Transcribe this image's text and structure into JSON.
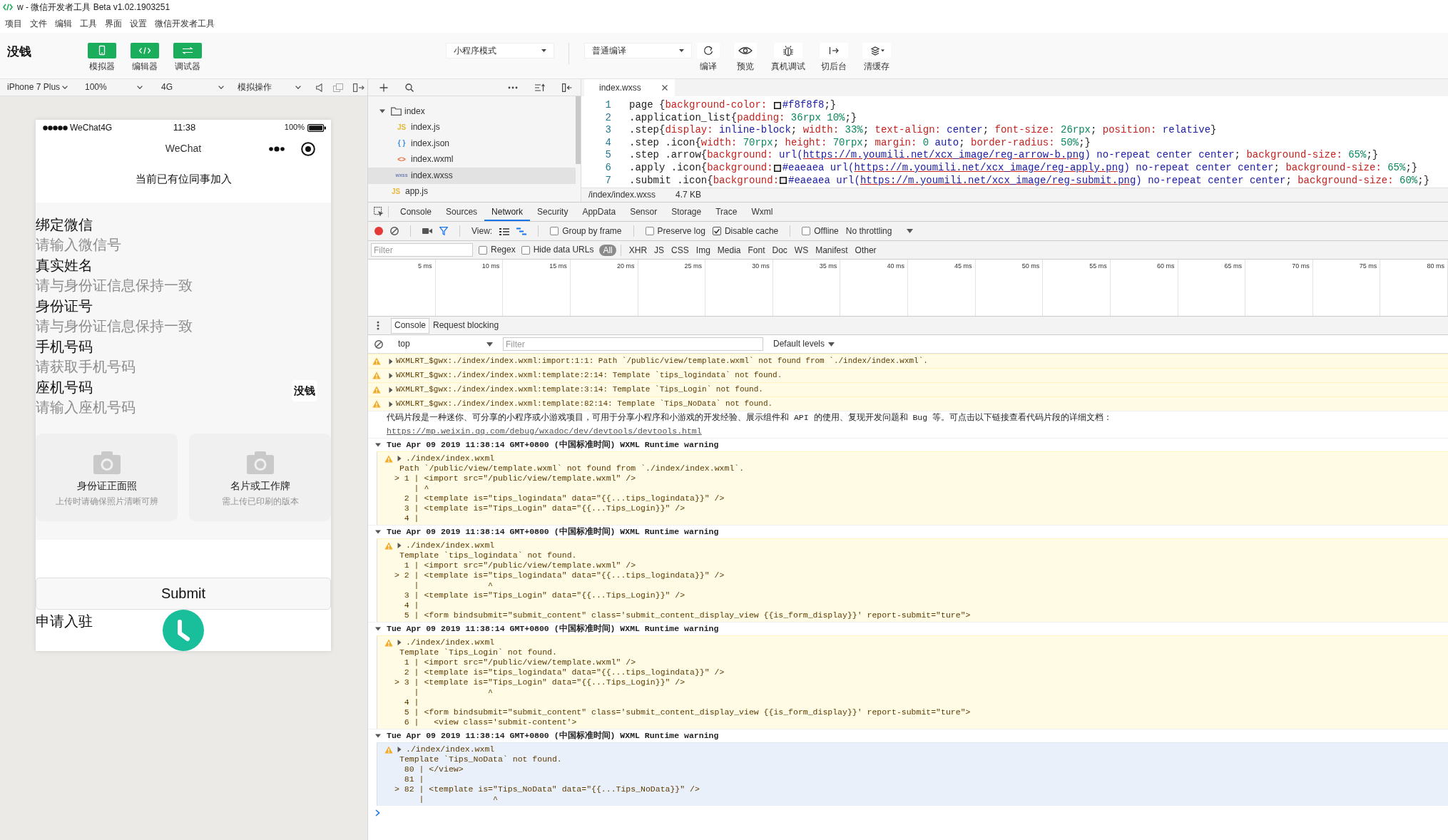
{
  "window": {
    "title": "w - 微信开发者工具 Beta v1.02.1903251"
  },
  "menu": [
    "项目",
    "文件",
    "编辑",
    "工具",
    "界面",
    "设置",
    "微信开发者工具"
  ],
  "toolbar": {
    "logo": "没钱",
    "view_buttons": [
      {
        "kind": "phone",
        "label": "模拟器",
        "on": true
      },
      {
        "kind": "code",
        "label": "编辑器",
        "on": true
      },
      {
        "kind": "swap",
        "label": "调试器",
        "on": true
      }
    ],
    "mode": "小程序模式",
    "compile": "普通编译",
    "actions": [
      {
        "kind": "refresh",
        "label": "编译"
      },
      {
        "kind": "eye",
        "label": "预览"
      },
      {
        "kind": "bug",
        "label": "真机调试"
      },
      {
        "kind": "background",
        "label": "切后台"
      },
      {
        "kind": "layers",
        "label": "清缓存"
      }
    ]
  },
  "simulator": {
    "device": "iPhone 7 Plus",
    "zoom": "100%",
    "network": "4G",
    "operation": "模拟操作",
    "phone": {
      "carrier": "WeChat4G",
      "time": "11:38",
      "battery": "100%",
      "nav_title": "WeChat",
      "header": "当前已有位同事加入",
      "fields": [
        {
          "label": "绑定微信",
          "placeholder": "请输入微信号"
        },
        {
          "label": "真实姓名",
          "placeholder": "请与身份证信息保持一致"
        },
        {
          "label": "身份证号",
          "placeholder": "请与身份证信息保持一致"
        },
        {
          "label": "手机号码",
          "placeholder": "请获取手机号码"
        },
        {
          "label": "座机号码",
          "placeholder": "请输入座机号码"
        }
      ],
      "badge": "没钱",
      "uploads": [
        {
          "title": "身份证正面照",
          "hint": "上传时请确保照片清晰可辨"
        },
        {
          "title": "名片或工作牌",
          "hint": "需上传已印刷的版本"
        }
      ],
      "submit": "Submit",
      "footer": "申请入驻"
    }
  },
  "file_tree": [
    {
      "kind": "folder",
      "name": "index",
      "expanded": true,
      "selected": false,
      "children": [
        {
          "kind": "js",
          "badge": "JS",
          "name": "index.js",
          "selected": false
        },
        {
          "kind": "json",
          "badge": "{ }",
          "name": "index.json",
          "selected": false
        },
        {
          "kind": "wxml",
          "badge": "<>",
          "name": "index.wxml",
          "selected": false
        },
        {
          "kind": "wxss",
          "badge": "wxss",
          "name": "index.wxss",
          "selected": true
        }
      ]
    },
    {
      "kind": "js",
      "badge": "JS",
      "name": "app.js",
      "selected": false
    }
  ],
  "editor": {
    "tabs": [
      {
        "label": "index.wxss",
        "selected": true
      }
    ],
    "lines": [
      {
        "number": "1",
        "tokens": [
          {
            "kind": "sel",
            "text": "page {"
          },
          {
            "kind": "prop",
            "text": "background-color: "
          },
          {
            "kind": "swatch",
            "color": "#f8f8f8"
          },
          {
            "kind": "val",
            "text": "#f8f8f8"
          },
          {
            "kind": "punct",
            "text": ";}"
          }
        ]
      },
      {
        "number": "2",
        "tokens": [
          {
            "kind": "sel",
            "text": ".application_list{"
          },
          {
            "kind": "prop",
            "text": "padding:"
          },
          {
            "kind": "num",
            "text": " 36rpx 10%"
          },
          {
            "kind": "punct",
            "text": ";}"
          }
        ]
      },
      {
        "number": "3",
        "tokens": [
          {
            "kind": "sel",
            "text": ".step{"
          },
          {
            "kind": "prop",
            "text": "display:"
          },
          {
            "kind": "val",
            "text": " inline-block"
          },
          {
            "kind": "punct",
            "text": "; "
          },
          {
            "kind": "prop",
            "text": "width:"
          },
          {
            "kind": "num",
            "text": " 33%"
          },
          {
            "kind": "punct",
            "text": "; "
          },
          {
            "kind": "prop",
            "text": "text-align:"
          },
          {
            "kind": "val",
            "text": " center"
          },
          {
            "kind": "punct",
            "text": "; "
          },
          {
            "kind": "prop",
            "text": "font-size:"
          },
          {
            "kind": "num",
            "text": " 26rpx"
          },
          {
            "kind": "punct",
            "text": "; "
          },
          {
            "kind": "prop",
            "text": "position:"
          },
          {
            "kind": "val",
            "text": " relative"
          },
          {
            "kind": "punct",
            "text": "}"
          }
        ]
      },
      {
        "number": "4",
        "tokens": [
          {
            "kind": "sel",
            "text": ".step .icon{"
          },
          {
            "kind": "prop",
            "text": "width:"
          },
          {
            "kind": "num",
            "text": " 70rpx"
          },
          {
            "kind": "punct",
            "text": "; "
          },
          {
            "kind": "prop",
            "text": "height:"
          },
          {
            "kind": "num",
            "text": " 70rpx"
          },
          {
            "kind": "punct",
            "text": "; "
          },
          {
            "kind": "prop",
            "text": "margin:"
          },
          {
            "kind": "num",
            "text": " 0"
          },
          {
            "kind": "val",
            "text": " auto"
          },
          {
            "kind": "punct",
            "text": "; "
          },
          {
            "kind": "prop",
            "text": "border-radius:"
          },
          {
            "kind": "num",
            "text": " 50%"
          },
          {
            "kind": "punct",
            "text": ";}"
          }
        ]
      },
      {
        "number": "5",
        "tokens": [
          {
            "kind": "sel",
            "text": ".step .arrow{"
          },
          {
            "kind": "prop",
            "text": "background:"
          },
          {
            "kind": "val",
            "text": " url("
          },
          {
            "kind": "url",
            "text": "https://m.youmili.net/xcx_image/reg-arrow-b.png"
          },
          {
            "kind": "val",
            "text": ") no-repeat center center"
          },
          {
            "kind": "punct",
            "text": "; "
          },
          {
            "kind": "prop",
            "text": "background-size:"
          },
          {
            "kind": "num",
            "text": " 65%"
          },
          {
            "kind": "punct",
            "text": ";}"
          }
        ]
      },
      {
        "number": "6",
        "tokens": [
          {
            "kind": "sel",
            "text": ".apply .icon{"
          },
          {
            "kind": "prop",
            "text": "background:"
          },
          {
            "kind": "swatch",
            "color": "#eaeaea"
          },
          {
            "kind": "val",
            "text": "#eaeaea url("
          },
          {
            "kind": "url",
            "text": "https://m.youmili.net/xcx_image/reg-apply.png"
          },
          {
            "kind": "val",
            "text": ") no-repeat center center"
          },
          {
            "kind": "punct",
            "text": "; "
          },
          {
            "kind": "prop",
            "text": "background-size:"
          },
          {
            "kind": "num",
            "text": " 65%"
          },
          {
            "kind": "punct",
            "text": ";}"
          }
        ]
      },
      {
        "number": "7",
        "tokens": [
          {
            "kind": "sel",
            "text": ".submit .icon{"
          },
          {
            "kind": "prop",
            "text": "background:"
          },
          {
            "kind": "swatch",
            "color": "#eaeaea"
          },
          {
            "kind": "val",
            "text": "#eaeaea url("
          },
          {
            "kind": "url",
            "text": "https://m.youmili.net/xcx_image/reg-submit.png"
          },
          {
            "kind": "val",
            "text": ") no-repeat center center"
          },
          {
            "kind": "punct",
            "text": "; "
          },
          {
            "kind": "prop",
            "text": "background-size:"
          },
          {
            "kind": "num",
            "text": " 60%"
          },
          {
            "kind": "punct",
            "text": ";}"
          }
        ]
      }
    ],
    "path": "/index/index.wxss",
    "size": "4.7 KB"
  },
  "devtools": {
    "tabs": [
      {
        "label": "Console",
        "selected": false
      },
      {
        "label": "Sources",
        "selected": false
      },
      {
        "label": "Network",
        "selected": true
      },
      {
        "label": "Security",
        "selected": false
      },
      {
        "label": "AppData",
        "selected": false
      },
      {
        "label": "Sensor",
        "selected": false
      },
      {
        "label": "Storage",
        "selected": false
      },
      {
        "label": "Trace",
        "selected": false
      },
      {
        "label": "Wxml",
        "selected": false
      }
    ],
    "network": {
      "recording": true,
      "view_label": "View:",
      "options": [
        {
          "label": "Group by frame",
          "checked": false
        },
        {
          "label": "Preserve log",
          "checked": false
        },
        {
          "label": "Disable cache",
          "checked": true
        },
        {
          "label": "Offline",
          "checked": false
        }
      ],
      "throttling": "No throttling",
      "filter_placeholder": "Filter",
      "filter_options": [
        {
          "label": "Regex",
          "checked": false
        },
        {
          "label": "Hide data URLs",
          "checked": false
        }
      ],
      "types": [
        {
          "label": "All",
          "selected": true
        },
        {
          "label": "XHR",
          "selected": false
        },
        {
          "label": "JS",
          "selected": false
        },
        {
          "label": "CSS",
          "selected": false
        },
        {
          "label": "Img",
          "selected": false
        },
        {
          "label": "Media",
          "selected": false
        },
        {
          "label": "Font",
          "selected": false
        },
        {
          "label": "Doc",
          "selected": false
        },
        {
          "label": "WS",
          "selected": false
        },
        {
          "label": "Manifest",
          "selected": false
        },
        {
          "label": "Other",
          "selected": false
        }
      ],
      "timeline_ticks": [
        "5 ms",
        "10 ms",
        "15 ms",
        "20 ms",
        "25 ms",
        "30 ms",
        "35 ms",
        "40 ms",
        "45 ms",
        "50 ms",
        "55 ms",
        "60 ms",
        "65 ms",
        "70 ms",
        "75 ms",
        "80 ms"
      ]
    },
    "console": {
      "tabs": [
        {
          "label": "Console",
          "selected": true
        },
        {
          "label": "Request blocking",
          "selected": false
        }
      ],
      "context": "top",
      "filter_placeholder": "Filter",
      "levels": "Default levels",
      "messages": [
        {
          "kind": "warning",
          "expanded": false,
          "text": "WXMLRT_$gwx:./index/index.wxml:import:1:1: Path `/public/view/template.wxml` not found from `./index/index.wxml`."
        },
        {
          "kind": "warning",
          "expanded": false,
          "text": "WXMLRT_$gwx:./index/index.wxml:template:2:14: Template `tips_logindata` not found."
        },
        {
          "kind": "warning",
          "expanded": false,
          "text": "WXMLRT_$gwx:./index/index.wxml:template:3:14: Template `Tips_Login` not found."
        },
        {
          "kind": "warning",
          "expanded": false,
          "text": "WXMLRT_$gwx:./index/index.wxml:template:82:14: Template `Tips_NoData` not found."
        },
        {
          "kind": "info",
          "text": "代码片段是一种迷你、可分享的小程序或小游戏项目，可用于分享小程序和小游戏的开发经验、展示组件和 API 的使用、复现开发问题和 Bug 等。可点击以下链接查看代码片段的详细文档：",
          "link": "https://mp.weixin.qq.com/debug/wxadoc/dev/devtools/devtools.html"
        },
        {
          "kind": "group",
          "header": "Tue Apr 09 2019 11:38:14 GMT+0800 (中国标准时间) WXML Runtime warning",
          "expanded": true,
          "selected": false,
          "file": "./index/index.wxml",
          "file_expanded": false,
          "message": "Path `/public/view/template.wxml` not found from `./index/index.wxml`.",
          "lines": [
            "> 1 | <import src=\"/public/view/template.wxml\" />",
            "    | ^",
            "  2 | <template is=\"tips_logindata\" data=\"{{...tips_logindata}}\" />",
            "  3 | <template is=\"Tips_Login\" data=\"{{...Tips_Login}}\" />",
            "  4 |"
          ]
        },
        {
          "kind": "group",
          "header": "Tue Apr 09 2019 11:38:14 GMT+0800 (中国标准时间) WXML Runtime warning",
          "expanded": true,
          "selected": false,
          "file": "./index/index.wxml",
          "file_expanded": false,
          "message": "Template `tips_logindata` not found.",
          "lines": [
            "  1 | <import src=\"/public/view/template.wxml\" />",
            "> 2 | <template is=\"tips_logindata\" data=\"{{...tips_logindata}}\" />",
            "    |              ^",
            "  3 | <template is=\"Tips_Login\" data=\"{{...Tips_Login}}\" />",
            "  4 |",
            "  5 | <form bindsubmit=\"submit_content\" class='submit_content_display_view {{is_form_display}}' report-submit=\"ture\">"
          ]
        },
        {
          "kind": "group",
          "header": "Tue Apr 09 2019 11:38:14 GMT+0800 (中国标准时间) WXML Runtime warning",
          "expanded": true,
          "selected": false,
          "file": "./index/index.wxml",
          "file_expanded": false,
          "message": "Template `Tips_Login` not found.",
          "lines": [
            "  1 | <import src=\"/public/view/template.wxml\" />",
            "  2 | <template is=\"tips_logindata\" data=\"{{...tips_logindata}}\" />",
            "> 3 | <template is=\"Tips_Login\" data=\"{{...Tips_Login}}\" />",
            "    |              ^",
            "  4 |",
            "  5 | <form bindsubmit=\"submit_content\" class='submit_content_display_view {{is_form_display}}' report-submit=\"ture\">",
            "  6 |   <view class='submit-content'>"
          ]
        },
        {
          "kind": "group",
          "header": "Tue Apr 09 2019 11:38:14 GMT+0800 (中国标准时间) WXML Runtime warning",
          "expanded": true,
          "selected": true,
          "file": "./index/index.wxml",
          "file_expanded": false,
          "message": "Template `Tips_NoData` not found.",
          "lines": [
            "  80 | </view>",
            "  81 |",
            "> 82 | <template is=\"Tips_NoData\" data=\"{{...Tips_NoData}}\" />",
            "     |              ^"
          ]
        }
      ]
    }
  }
}
